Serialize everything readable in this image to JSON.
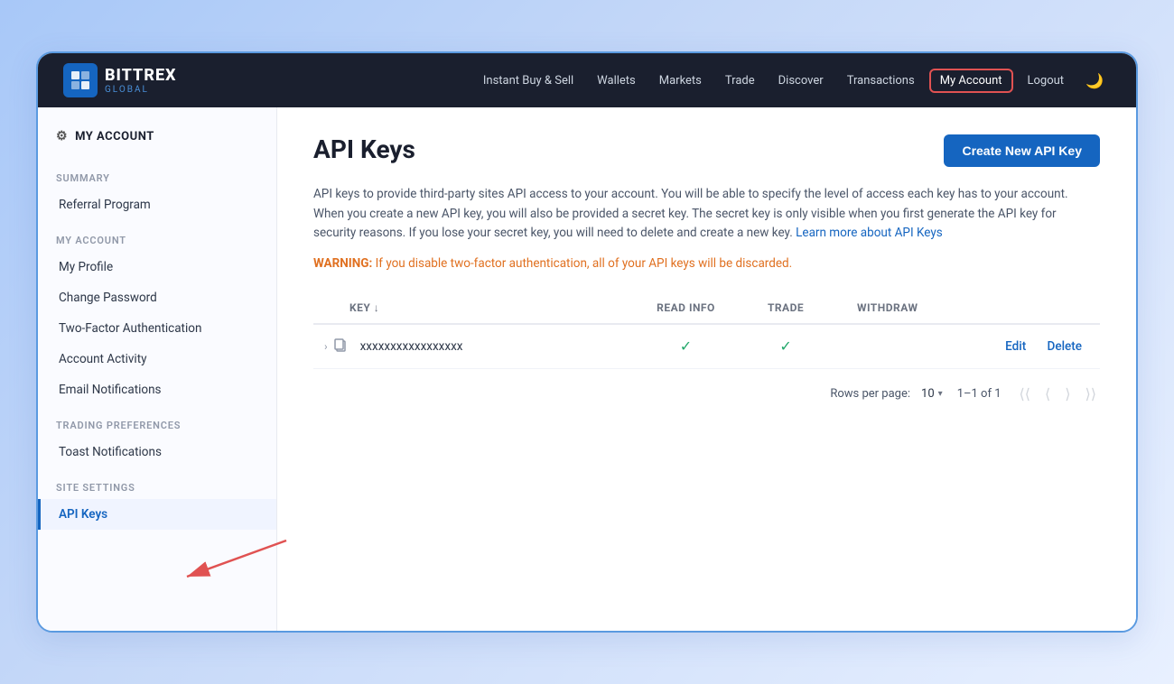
{
  "header": {
    "logo_brand": "BITTREX",
    "logo_sub": "GLOBAL",
    "nav_links": [
      {
        "label": "Instant Buy & Sell",
        "active": false
      },
      {
        "label": "Wallets",
        "active": false
      },
      {
        "label": "Markets",
        "active": false
      },
      {
        "label": "Trade",
        "active": false
      },
      {
        "label": "Discover",
        "active": false
      },
      {
        "label": "Transactions",
        "active": false
      },
      {
        "label": "My Account",
        "active": true
      },
      {
        "label": "Logout",
        "active": false
      }
    ],
    "dark_mode_icon": "🌙"
  },
  "sidebar": {
    "my_account_label": "MY ACCOUNT",
    "summary_label": "SUMMARY",
    "referral_program": "Referral Program",
    "my_account_section": "MY ACCOUNT",
    "account_items": [
      {
        "label": "My Profile",
        "active": false
      },
      {
        "label": "Change Password",
        "active": false
      },
      {
        "label": "Two-Factor Authentication",
        "active": false
      },
      {
        "label": "Account Activity",
        "active": false
      },
      {
        "label": "Email Notifications",
        "active": false
      }
    ],
    "trading_preferences_label": "TRADING PREFERENCES",
    "trading_items": [
      {
        "label": "Toast Notifications",
        "active": false
      }
    ],
    "site_settings_label": "SITE SETTINGS",
    "site_items": [
      {
        "label": "API Keys",
        "active": true
      }
    ]
  },
  "content": {
    "page_title": "API Keys",
    "create_button": "Create New API Key",
    "description": "API keys to provide third-party sites API access to your account. You will be able to specify the level of access each key has to your account. When you create a new API key, you will also be provided a secret key. The secret key is only visible when you first generate the API key for security reasons. If you lose your secret key, you will need to delete and create a new key.",
    "learn_more_text": "Learn more about API Keys",
    "warning_label": "WARNING:",
    "warning_message": "If you disable two-factor authentication, all of your API keys will be discarded.",
    "table": {
      "columns": [
        {
          "label": "KEY ↓",
          "key": "key"
        },
        {
          "label": "READ INFO",
          "key": "read_info"
        },
        {
          "label": "TRADE",
          "key": "trade"
        },
        {
          "label": "WITHDRAW",
          "key": "withdraw"
        }
      ],
      "rows": [
        {
          "key_value": "xxxxxxxxxxxxxxxxx",
          "read_info": true,
          "trade": true,
          "withdraw": false,
          "edit_label": "Edit",
          "delete_label": "Delete"
        }
      ]
    },
    "pagination": {
      "rows_per_page_label": "Rows per page:",
      "rows_per_page_value": "10",
      "page_info": "1–1 of 1"
    }
  }
}
